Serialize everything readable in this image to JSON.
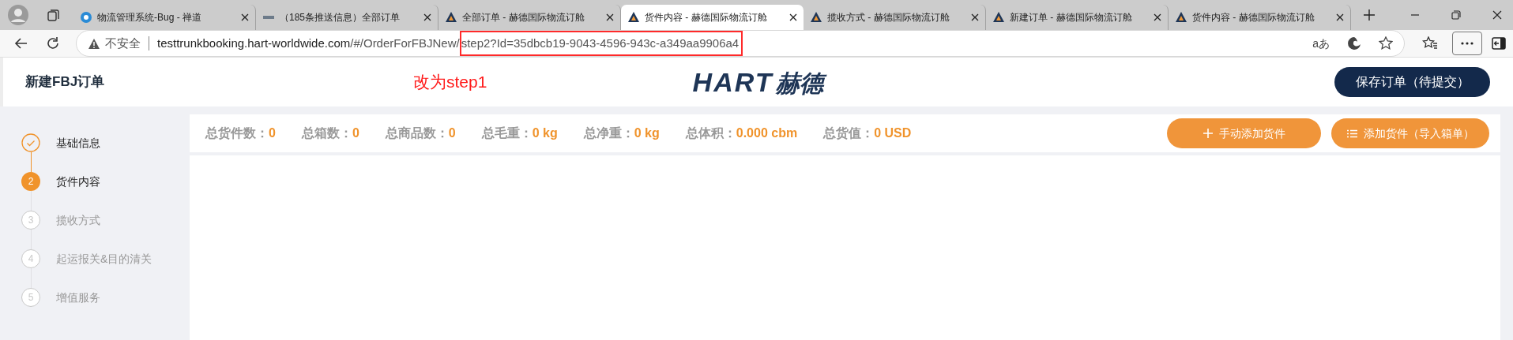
{
  "browser": {
    "tabs": [
      {
        "title": "物流管理系统-Bug - 禅道",
        "selected": false
      },
      {
        "title": "（185条推送信息）全部订单",
        "selected": false
      },
      {
        "title": "全部订单 - 赫德国际物流订舱",
        "selected": false
      },
      {
        "title": "货件内容 - 赫德国际物流订舱",
        "selected": true
      },
      {
        "title": "揽收方式 - 赫德国际物流订舱",
        "selected": false
      },
      {
        "title": "新建订单 - 赫德国际物流订舱",
        "selected": false
      },
      {
        "title": "货件内容 - 赫德国际物流订舱",
        "selected": false
      }
    ],
    "security_label": "不安全",
    "url_host": "testtrunkbooking.hart-worldwide.com",
    "url_path": "/#/OrderForFBJNew/",
    "url_query": "step2?Id=35dbcb19-9043-4596-943c-a349aa9906a4",
    "read_aloud": "aあ"
  },
  "annotation": {
    "text": "改为step1"
  },
  "header": {
    "title": "新建FBJ订单",
    "logo_latin": "HART",
    "logo_cjk": "赫德",
    "save_button": "保存订单（待提交）"
  },
  "steps": [
    {
      "label": "基础信息",
      "done": true,
      "selected": false
    },
    {
      "label": "货件内容",
      "number": "2",
      "done": false,
      "selected": true
    },
    {
      "label": "揽收方式",
      "number": "3",
      "done": false,
      "selected": false
    },
    {
      "label": "起运报关&目的清关",
      "number": "4",
      "done": false,
      "selected": false
    },
    {
      "label": "增值服务",
      "number": "5",
      "done": false,
      "selected": false
    }
  ],
  "summary": [
    {
      "label": "总货件数：",
      "value": "0"
    },
    {
      "label": "总箱数：",
      "value": "0"
    },
    {
      "label": "总商品数：",
      "value": "0"
    },
    {
      "label": "总毛重：",
      "value": "0 kg"
    },
    {
      "label": "总净重：",
      "value": "0 kg"
    },
    {
      "label": "总体积：",
      "value": "0.000 cbm"
    },
    {
      "label": "总货值：",
      "value": "0 USD"
    }
  ],
  "actions": [
    {
      "label": "手动添加货件",
      "kind": "plus"
    },
    {
      "label": "添加货件（导入箱单）",
      "kind": "list"
    }
  ]
}
